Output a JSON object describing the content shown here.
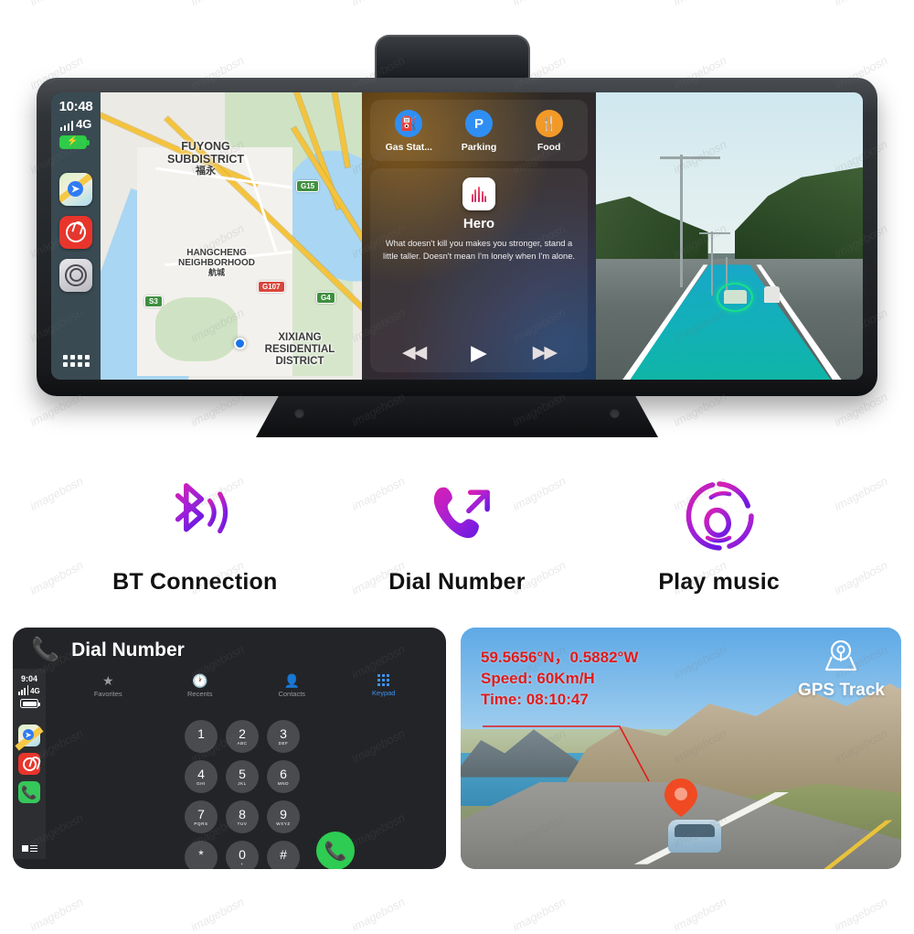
{
  "hero": {
    "carplay": {
      "status": {
        "time": "10:48",
        "network": "4G",
        "battery_state": "charging"
      },
      "sidebar_apps": [
        {
          "name": "maps-app",
          "label": "Maps"
        },
        {
          "name": "netease-music-app",
          "label": "NetEase Music"
        },
        {
          "name": "carplay-settings-app",
          "label": "Settings"
        }
      ],
      "app_grid_label": "All Apps",
      "map": {
        "labels": [
          {
            "line1": "FUYONG",
            "line2": "SUBDISTRICT",
            "line3": "福永"
          },
          {
            "line1": "HANGCHENG",
            "line2": "NEIGHBORHOOD",
            "line3": "航城"
          },
          {
            "line1": "XIXIANG",
            "line2": "RESIDENTIAL",
            "line3": "DISTRICT"
          }
        ],
        "shields": [
          "G15",
          "S3",
          "G107",
          "G4"
        ]
      },
      "quick_actions": [
        {
          "label": "Gas Stat...",
          "icon": "gas-pump-icon",
          "color": "#2f8ef4"
        },
        {
          "label": "Parking",
          "icon": "parking-p-icon",
          "color": "#2f8ef4"
        },
        {
          "label": "Food",
          "icon": "fork-knife-icon",
          "color": "#f29a28"
        }
      ],
      "now_playing": {
        "title": "Hero",
        "lyrics": "What doesn't kill you makes you stronger, stand a little taller. Doesn't mean I'm lonely when I'm alone.",
        "controls": [
          "rewind",
          "play",
          "fast-forward"
        ]
      }
    }
  },
  "features": [
    {
      "label": "BT  Connection",
      "icon": "bluetooth-icon"
    },
    {
      "label": "Dial Number",
      "icon": "phone-outgoing-icon"
    },
    {
      "label": "Play music",
      "icon": "music-disc-icon"
    }
  ],
  "dial_panel": {
    "header": {
      "title": "Dial Number",
      "icon": "phone-outgoing-icon"
    },
    "status": {
      "time": "9:04",
      "network": "4G"
    },
    "tabs": [
      {
        "label": "Favorites",
        "icon": "star-icon",
        "active": false
      },
      {
        "label": "Recents",
        "icon": "clock-icon",
        "active": false
      },
      {
        "label": "Contacts",
        "icon": "person-circle-icon",
        "active": false
      },
      {
        "label": "Keypad",
        "icon": "keypad-grid-icon",
        "active": true
      }
    ],
    "keys": [
      {
        "digit": "1",
        "letters": ""
      },
      {
        "digit": "2",
        "letters": "ABC"
      },
      {
        "digit": "3",
        "letters": "DEF"
      },
      {
        "digit": "4",
        "letters": "GHI"
      },
      {
        "digit": "5",
        "letters": "JKL"
      },
      {
        "digit": "6",
        "letters": "MNO"
      },
      {
        "digit": "7",
        "letters": "PQRS"
      },
      {
        "digit": "8",
        "letters": "TUV"
      },
      {
        "digit": "9",
        "letters": "WXYZ"
      },
      {
        "digit": "*",
        "letters": ""
      },
      {
        "digit": "0",
        "letters": "+"
      },
      {
        "digit": "#",
        "letters": ""
      }
    ],
    "call_button_label": "Call",
    "accent_color": "#3b93f0",
    "call_color": "#2ecc52"
  },
  "gps_panel": {
    "badge_label": "GPS Track",
    "badge_icon": "location-pin-map-icon",
    "coordinates": "59.5656°N，0.5882°W",
    "speed": "Speed: 60Km/H",
    "time": "Time: 08:10:47",
    "overlay_color": "#e01b1b",
    "pin_color": "#f04a23"
  },
  "watermark_text": "imagebosn"
}
